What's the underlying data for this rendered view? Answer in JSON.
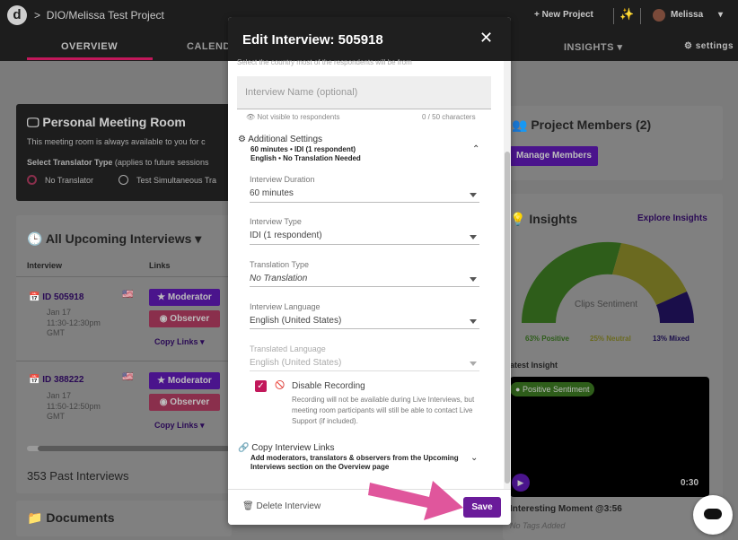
{
  "header": {
    "breadcrumb": "DIO/Melissa Test Project",
    "new_project": "+ New Project",
    "user": "Melissa",
    "settings": "settings"
  },
  "tabs": {
    "overview": "OVERVIEW",
    "calendar": "CALEND",
    "insights": "INSIGHTS"
  },
  "pmr": {
    "title": "Personal Meeting Room",
    "desc": "This meeting room is always available to you for c",
    "translator": "Select Translator Type",
    "translator_note": "(applies to future sessions",
    "opt1": "No Translator",
    "opt2": "Test Simultaneous Tra"
  },
  "upcoming": {
    "title": "All Upcoming Interviews",
    "col_interview": "Interview",
    "col_links": "Links",
    "rows": [
      {
        "id": "ID 505918",
        "date": "Jan 17",
        "time": "11:30-12:30pm",
        "tz": "GMT",
        "moderator": "Moderator",
        "observer": "Observer",
        "copy": "Copy Links"
      },
      {
        "id": "ID 388222",
        "date": "Jan 17",
        "time": "11:50-12:50pm",
        "tz": "GMT",
        "moderator": "Moderator",
        "observer": "Observer",
        "copy": "Copy Links"
      }
    ],
    "past": "353 Past Interviews"
  },
  "documents": {
    "title": "Documents"
  },
  "members": {
    "title": "Project Members (2)",
    "manage": "Manage Members"
  },
  "insights": {
    "title": "Insights",
    "explore": "Explore Insights",
    "gauge_label": "Clips Sentiment",
    "positive": "63% Positive",
    "neutral": "25% Neutral",
    "mixed": "13% Mixed",
    "latest": "atest Insight",
    "badge": "Positive Sentiment",
    "duration": "0:30",
    "moment": "Interesting Moment @3:56",
    "tags": "No Tags Added"
  },
  "modal": {
    "title": "Edit Interview: 505918",
    "country_note": "Select the country most of the respondents will be from",
    "name_placeholder": "Interview Name (optional)",
    "visibility": "Not visible to respondents",
    "char_count": "0 / 50 characters",
    "settings_title": "Additional Settings",
    "settings_line1": "60 minutes • IDI (1 respondent)",
    "settings_line2": "English • No Translation Needed",
    "duration_label": "Interview Duration",
    "duration_value": "60 minutes",
    "type_label": "Interview Type",
    "type_value": "IDI (1 respondent)",
    "translation_label": "Translation Type",
    "translation_value": "No Translation",
    "language_label": "Interview Language",
    "language_value": "English (United States)",
    "translated_label": "Translated Language",
    "translated_value": "English (United States)",
    "recording_label": "Disable Recording",
    "recording_note": "Recording will not be available during Live Interviews, but meeting room participants will still be able to contact Live Support (if included).",
    "copy_title": "Copy Interview Links",
    "copy_note": "Add moderators, translators & observers from the Upcoming Interviews section on the Overview page",
    "delete": "Delete Interview",
    "save": "Save"
  },
  "colors": {
    "primary": "#6a1b9a",
    "accent": "#c2185b",
    "positive": "#4caf50",
    "neutral": "#c0ca33",
    "mixed": "#311b92"
  }
}
